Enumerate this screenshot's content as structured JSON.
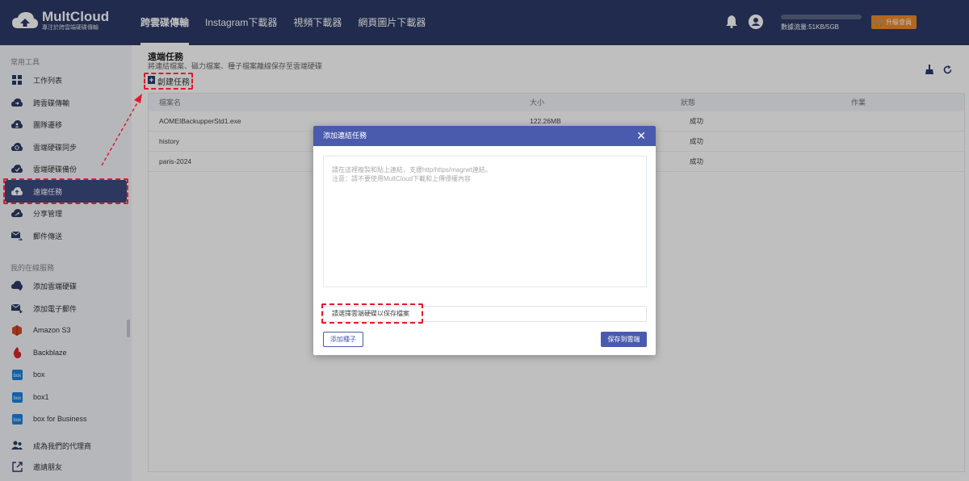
{
  "header": {
    "logo_title": "MultCloud",
    "logo_sub": "專注於跨雲端硬碟傳輸",
    "nav": [
      "跨雲碟傳輸",
      "Instagram下載器",
      "視頻下載器",
      "網頁圖片下載器"
    ],
    "traffic_text": "數據流量:51KB/5GB",
    "upgrade": "升級會員"
  },
  "sidebar": {
    "section1": "常用工具",
    "tools": [
      "工作列表",
      "跨雲碟傳輸",
      "團隊遷移",
      "雲端硬碟同步",
      "雲端硬碟備份",
      "遠端任務",
      "分享管理",
      "郵件傳送"
    ],
    "section2": "我的在線服務",
    "services": [
      "添加雲端硬碟",
      "添加電子郵件",
      "Amazon S3",
      "Backblaze",
      "box",
      "box1",
      "box for Business"
    ],
    "bottom": [
      "成為我們的代理商",
      "邀請朋友"
    ]
  },
  "main": {
    "title": "遠端任務",
    "subtitle": "將連結檔案、磁力檔案、種子檔案離線保存至雲端硬碟",
    "create": "創建任務",
    "columns": [
      "檔案名",
      "大小",
      "狀態",
      "作業"
    ],
    "rows": [
      {
        "name": "AOMEIBackupperStd1.exe",
        "size": "122.26MB",
        "status": "成功"
      },
      {
        "name": "history",
        "size": "",
        "status": "成功"
      },
      {
        "name": "paris-2024",
        "size": "",
        "status": "成功"
      }
    ]
  },
  "modal": {
    "title": "添加連結任務",
    "placeholder_line1": "請在這裡複製和貼上連結，支援http/https/magnet連結。",
    "placeholder_line2": "注意：請不要使用MultCloud下載和上傳侵權內容",
    "save_location": "請選擇雲端硬碟以保存檔案",
    "add_seed": "添加種子",
    "save_btn": "保存到雲端"
  },
  "colors": {
    "header_bg": "#2b3a67",
    "accent": "#4a5bae",
    "upgrade": "#f08a28",
    "highlight": "#e1192f"
  }
}
